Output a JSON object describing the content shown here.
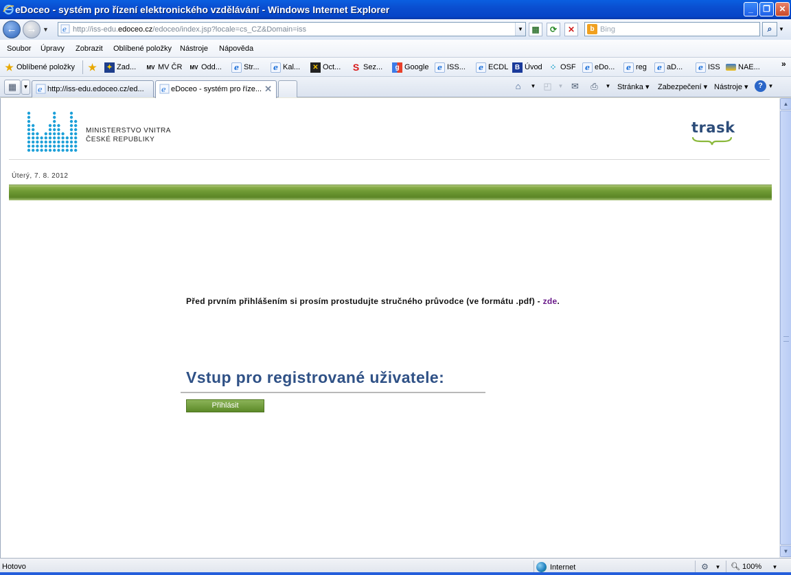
{
  "window": {
    "title": "eDoceo - systém pro řízení elektronického vzdělávání - Windows Internet Explorer",
    "buttons": {
      "minimize": "_",
      "maximize": "❐",
      "close": "✕"
    }
  },
  "address": {
    "url_prefix": "http://iss-edu.",
    "url_domain": "edoceo.cz",
    "url_suffix": "/edoceo/index.jsp?locale=cs_CZ&Domain=iss",
    "search_placeholder": "Bing"
  },
  "menu": [
    "Soubor",
    "Úpravy",
    "Zobrazit",
    "Oblíbené položky",
    "Nástroje",
    "Nápověda"
  ],
  "favorites": {
    "label": "Oblíbené položky",
    "items": [
      "Zad...",
      "MV ČR",
      "Odd...",
      "Str...",
      "Kal...",
      "Oct...",
      "Sez...",
      "Google",
      "ISS...",
      "ECDL",
      "Úvod",
      "OSF",
      "eDo...",
      "reg",
      "aD...",
      "ISS",
      "NAE..."
    ]
  },
  "tabs": [
    {
      "label": "http://iss-edu.edoceo.cz/ed..."
    },
    {
      "label": "eDoceo - systém pro říze..."
    }
  ],
  "commands": {
    "page": "Stránka",
    "security": "Zabezpečení",
    "tools": "Nástroje"
  },
  "page": {
    "ministry_line1": "MINISTERSTVO VNITRA",
    "ministry_line2": "ČESKÉ REPUBLIKY",
    "trask_logo": "trask",
    "date": "Úterý, 7. 8. 2012",
    "intro_text": "Před prvním přihlášením si prosím prostudujte stručného průvodce (ve formátu .pdf) - ",
    "intro_link": "zde",
    "intro_end": ".",
    "heading": "Vstup pro registrované uživatele:",
    "login_button": "Přihlásit"
  },
  "status": {
    "text": "Hotovo",
    "zone": "Internet",
    "zoom": "100%"
  },
  "colors": {
    "accent_green": "#6f9a34",
    "heading_blue": "#2f5186",
    "titlebar_blue": "#0a4ed0"
  }
}
